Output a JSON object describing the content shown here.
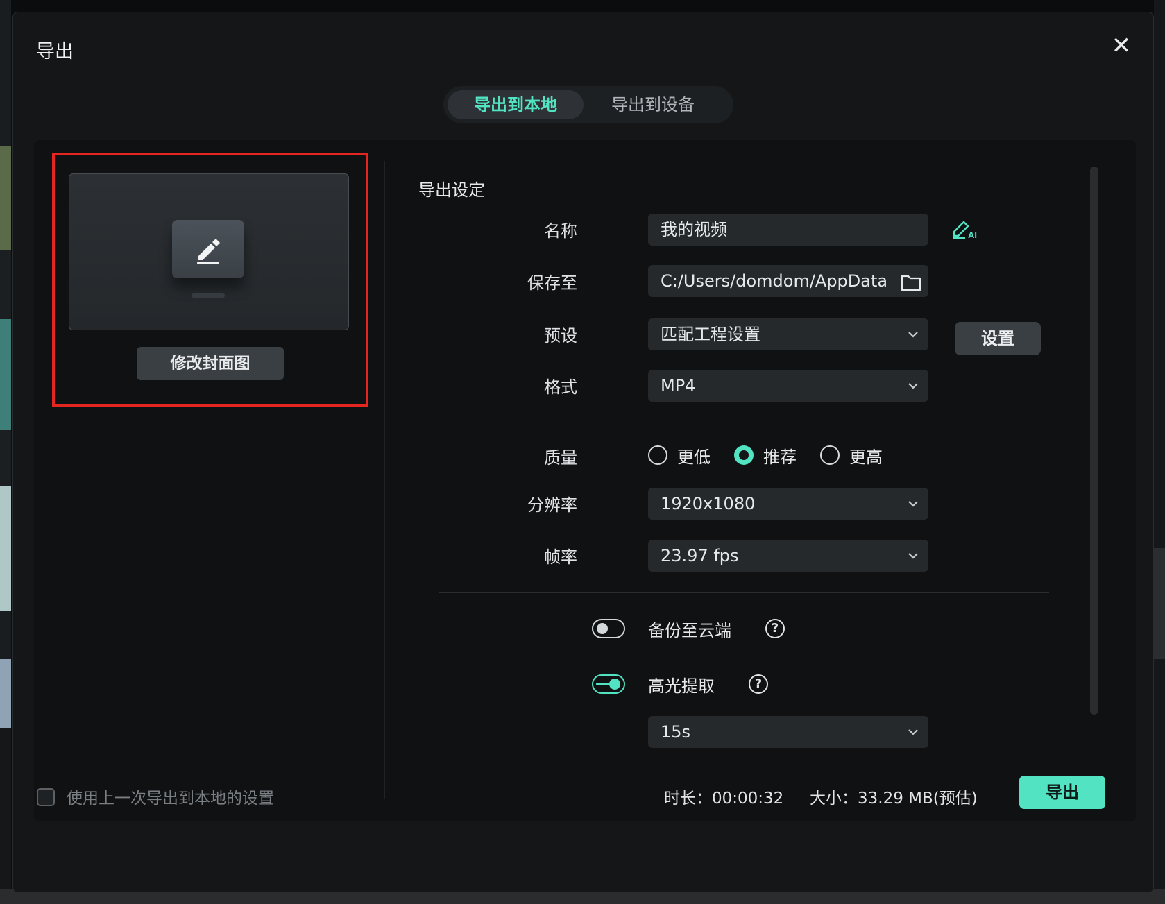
{
  "dialog": {
    "title": "导出",
    "close_icon": "close-icon"
  },
  "tabs": [
    {
      "label": "导出到本地",
      "active": true
    },
    {
      "label": "导出到设备",
      "active": false
    }
  ],
  "cover": {
    "edit_icon": "pencil-edit-icon",
    "button_label": "修改封面图"
  },
  "settings": {
    "section_title": "导出设定",
    "name": {
      "label": "名称",
      "value": "我的视频",
      "ai_icon": "ai-pen-icon"
    },
    "save_to": {
      "label": "保存至",
      "value": "C:/Users/domdom/AppData",
      "folder_icon": "folder-icon"
    },
    "preset": {
      "label": "预设",
      "value": "匹配工程设置",
      "button_label": "设置"
    },
    "format": {
      "label": "格式",
      "value": "MP4"
    },
    "quality": {
      "label": "质量",
      "options": [
        "更低",
        "推荐",
        "更高"
      ],
      "selected": "推荐"
    },
    "resolution": {
      "label": "分辨率",
      "value": "1920x1080"
    },
    "frame_rate": {
      "label": "帧率",
      "value": "23.97 fps"
    },
    "cloud_backup": {
      "label": "备份至云端",
      "enabled": false
    },
    "highlight": {
      "label": "高光提取",
      "enabled": true,
      "duration": "15s"
    }
  },
  "footer": {
    "remember_label": "使用上一次导出到本地的设置",
    "remember_checked": false,
    "duration_text": "时长：00:00:32",
    "size_text": "大小：33.29 MB(预估)",
    "export_label": "导出"
  },
  "colors": {
    "accent": "#52e3c2",
    "dialog_bg": "#141617",
    "panel_bg": "#0f1112",
    "highlight_border": "#e5251f"
  }
}
